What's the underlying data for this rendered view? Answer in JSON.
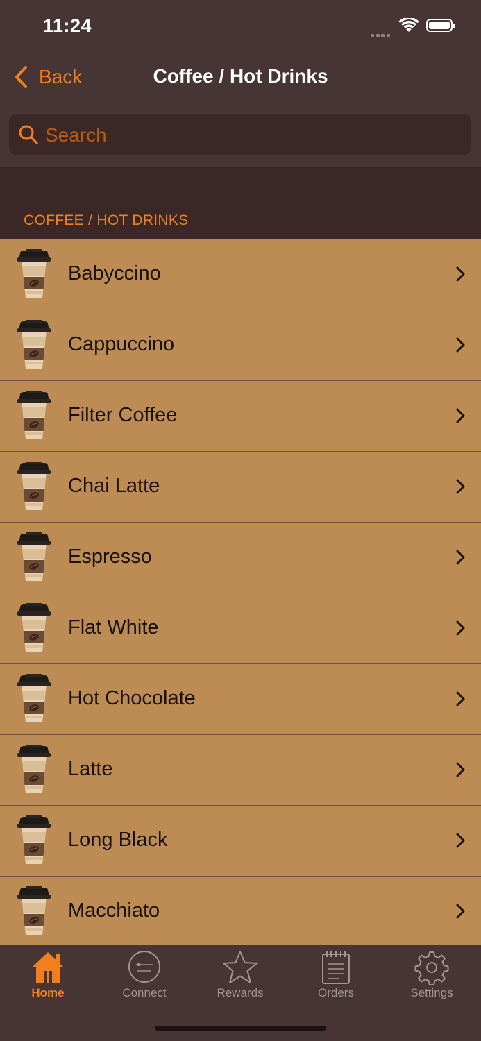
{
  "status": {
    "time": "11:24"
  },
  "nav": {
    "back_label": "Back",
    "title": "Coffee / Hot Drinks"
  },
  "search": {
    "placeholder": "Search",
    "value": ""
  },
  "section": {
    "title": "COFFEE / HOT DRINKS"
  },
  "items": [
    {
      "label": "Babyccino"
    },
    {
      "label": "Cappuccino"
    },
    {
      "label": "Filter Coffee"
    },
    {
      "label": "Chai Latte"
    },
    {
      "label": "Espresso"
    },
    {
      "label": "Flat White"
    },
    {
      "label": "Hot Chocolate"
    },
    {
      "label": "Latte"
    },
    {
      "label": "Long Black"
    },
    {
      "label": "Macchiato"
    }
  ],
  "tabs": [
    {
      "label": "Home",
      "icon": "home-icon",
      "active": true
    },
    {
      "label": "Connect",
      "icon": "connect-logo-icon",
      "active": false
    },
    {
      "label": "Rewards",
      "icon": "star-icon",
      "active": false
    },
    {
      "label": "Orders",
      "icon": "notepad-icon",
      "active": false
    },
    {
      "label": "Settings",
      "icon": "gear-icon",
      "active": false
    }
  ],
  "colors": {
    "accent": "#f07f1d",
    "background": "#473535",
    "section_bg": "#3b2826",
    "row_bg": "#bd8c55"
  }
}
